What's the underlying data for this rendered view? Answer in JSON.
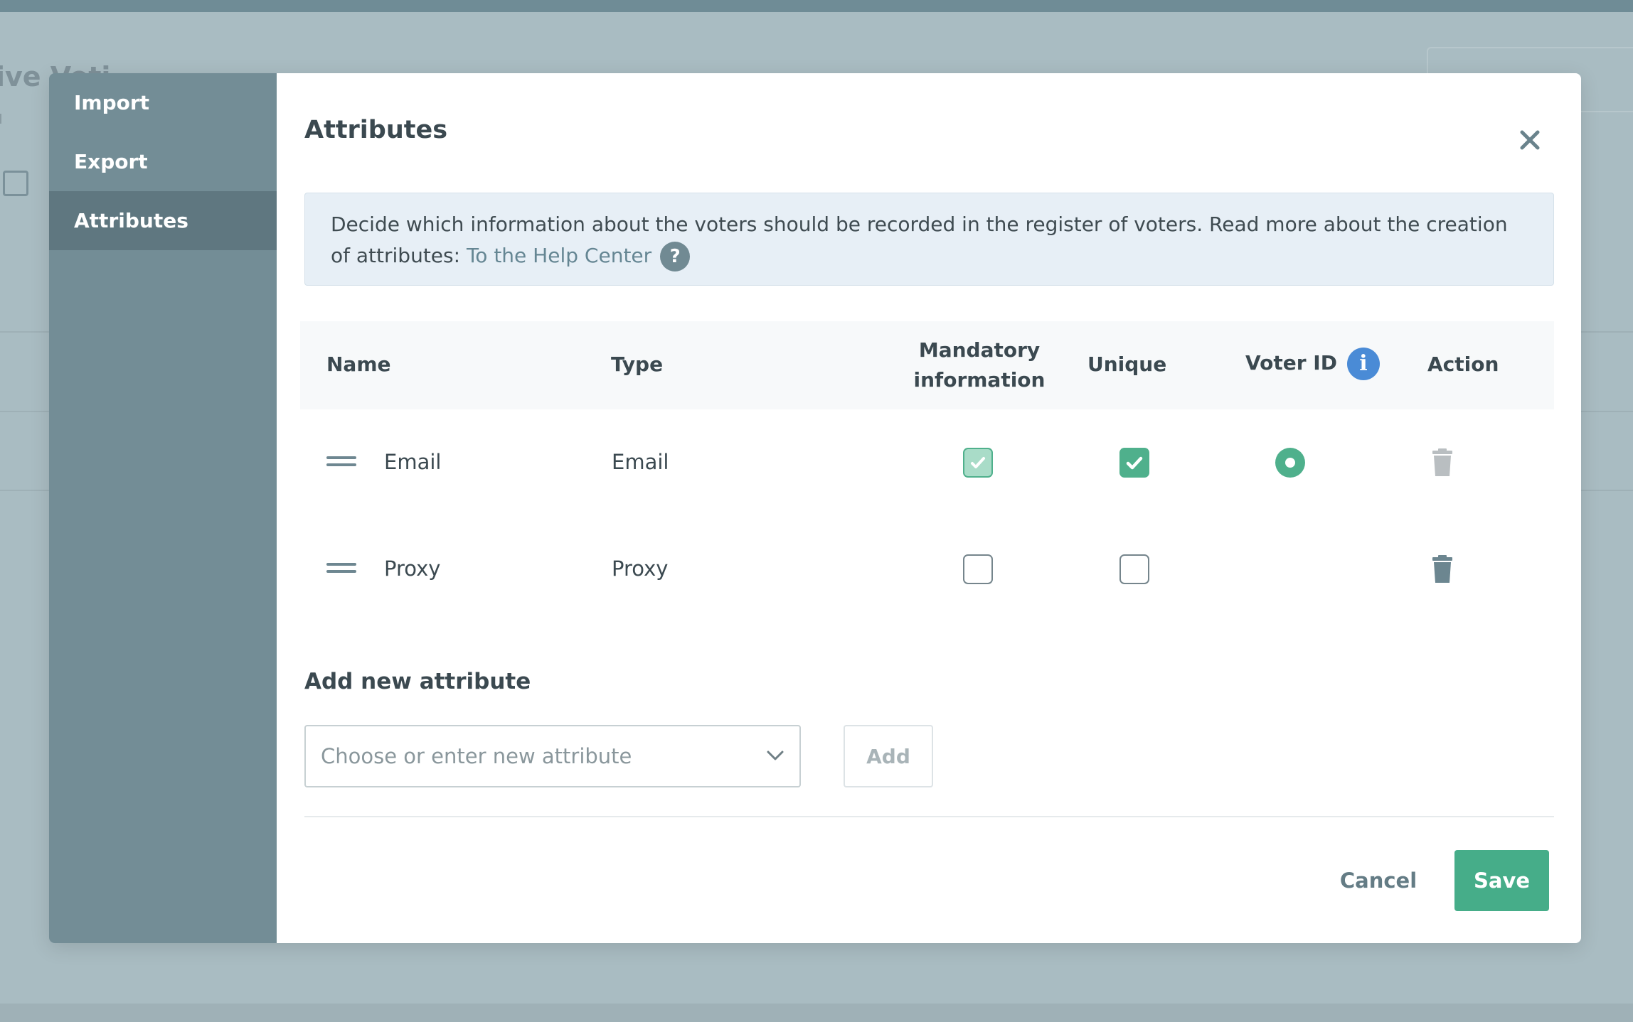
{
  "background": {
    "title_fragment": "ive Voti"
  },
  "sidebar": {
    "items": [
      {
        "label": "Import",
        "active": false
      },
      {
        "label": "Export",
        "active": false
      },
      {
        "label": "Attributes",
        "active": true
      }
    ]
  },
  "dialog": {
    "title": "Attributes",
    "close_icon": "close-icon",
    "info": {
      "text": "Decide which information about the voters should be recorded in the register of voters. Read more about the creation of attributes: ",
      "link_label": "To the Help Center",
      "help_icon_glyph": "?"
    }
  },
  "table": {
    "headers": {
      "name": "Name",
      "type": "Type",
      "mandatory_line1": "Mandatory",
      "mandatory_line2": "information",
      "unique": "Unique",
      "voter_id": "Voter ID",
      "voter_id_info_glyph": "i",
      "action": "Action"
    },
    "rows": [
      {
        "name": "Email",
        "type": "Email",
        "mandatory": true,
        "mandatory_locked": true,
        "unique": true,
        "voter_id": true,
        "delete_disabled": true
      },
      {
        "name": "Proxy",
        "type": "Proxy",
        "mandatory": false,
        "mandatory_locked": false,
        "unique": false,
        "voter_id": false,
        "delete_disabled": false
      }
    ]
  },
  "add_attribute": {
    "heading": "Add new attribute",
    "placeholder": "Choose or enter new attribute",
    "add_label": "Add"
  },
  "footer": {
    "cancel_label": "Cancel",
    "save_label": "Save"
  },
  "colors": {
    "sidebar": "#738d96",
    "sidebar_active": "#5f7780",
    "accent_green": "#46ad89",
    "info_blue": "#4a8bd6",
    "info_box_bg": "#e7eff6"
  }
}
